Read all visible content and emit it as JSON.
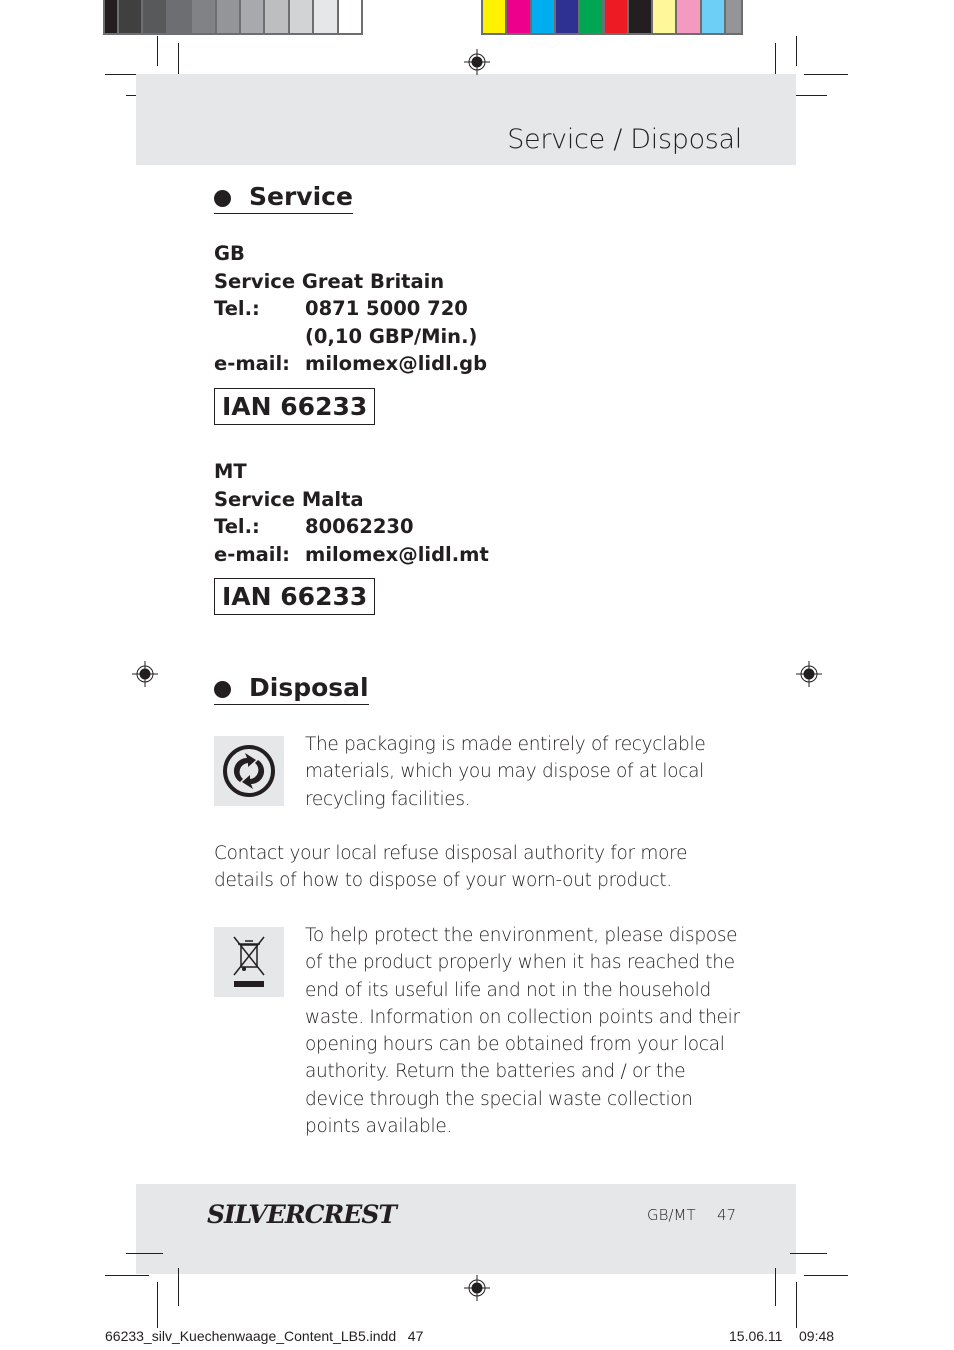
{
  "color_bar": {
    "grays": [
      "#231f20",
      "#404041",
      "#58595b",
      "#6d6e71",
      "#808285",
      "#939598",
      "#a7a9ac",
      "#bcbec0",
      "#d1d3d4",
      "#e6e7e8",
      "#ffffff"
    ],
    "colors": [
      "#fff200",
      "#ec008c",
      "#00aeef",
      "#2e3192",
      "#00a651",
      "#ed1c24",
      "#231f20",
      "#fff799",
      "#f49ac1",
      "#6dcff6",
      "#939598"
    ]
  },
  "header": {
    "title": "Service / Disposal"
  },
  "service": {
    "heading": "Service",
    "gb": {
      "country": "GB",
      "name": "Service Great Britain",
      "tel_label": "Tel.:",
      "tel": "0871 5000 720",
      "tel_rate": "(0,10 GBP/Min.)",
      "email_label": "e-mail:",
      "email": "milomex@lidl.gb",
      "ian": "IAN 66233"
    },
    "mt": {
      "country": "MT",
      "name": "Service Malta",
      "tel_label": "Tel.:",
      "tel": "80062230",
      "email_label": "e-mail:",
      "email": "milomex@lidl.mt",
      "ian": "IAN 66233"
    }
  },
  "disposal": {
    "heading": "Disposal",
    "para1": "The packaging is made entirely of recyclable materials, which you may dispose of at local recycling facilities.",
    "para2": "Contact your local refuse disposal authority for more details of how to dispose of your worn-out product.",
    "para3": "To help protect the environment, please dispose of the product properly when it has reached the end of its useful life and not in the household waste. Information on collection points and their opening hours can be obtained from your local authority. Return the batteries and / or the device through the special waste collection points available.",
    "icons": [
      "green-dot-recycling-icon",
      "crossed-out-wheelie-bin-icon"
    ]
  },
  "footer": {
    "brand": "SilverCrest",
    "lang": "GB/MT",
    "page": "47"
  },
  "print_meta": {
    "file": "66233_silv_Kuechenwaage_Content_LB5.indd   47",
    "date": "15.06.11",
    "time": "09:48"
  }
}
